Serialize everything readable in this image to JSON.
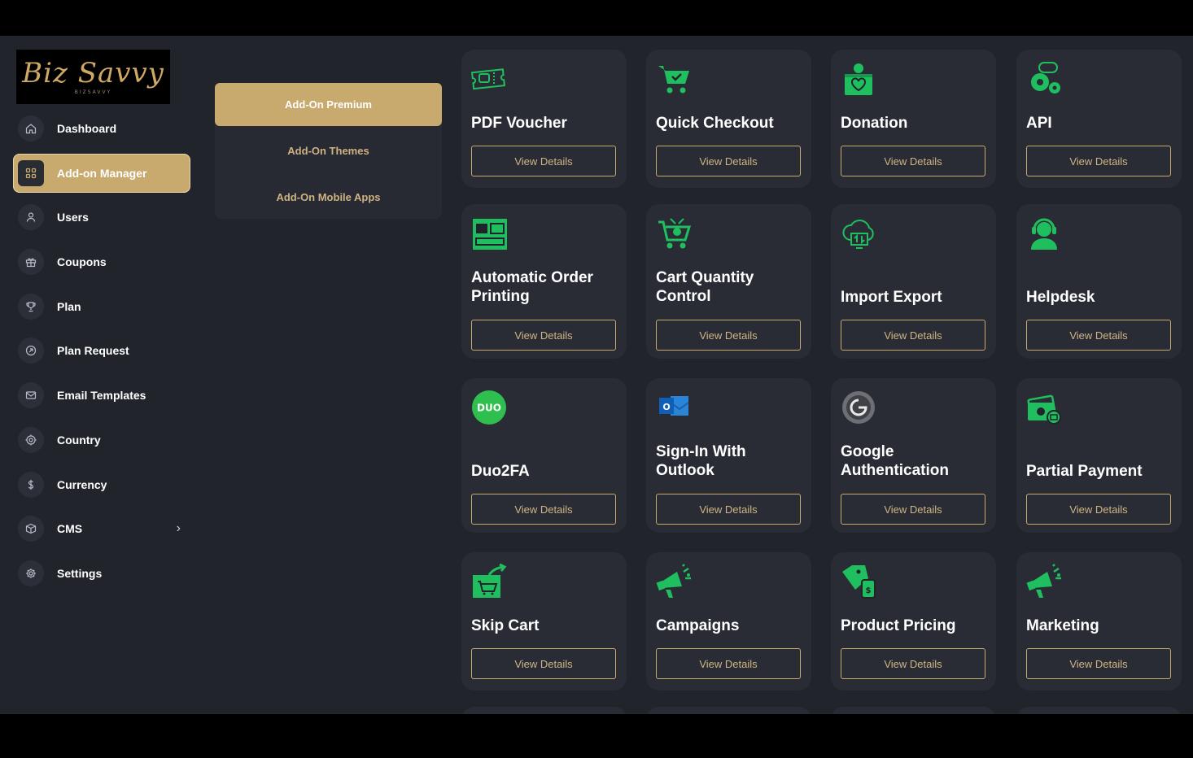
{
  "logo": {
    "script": "Biz Savvy",
    "sub": "BIZSAVVY"
  },
  "sidebar": {
    "items": [
      {
        "label": "Dashboard",
        "icon": "home-icon"
      },
      {
        "label": "Add-on Manager",
        "icon": "grid-icon"
      },
      {
        "label": "Users",
        "icon": "user-icon"
      },
      {
        "label": "Coupons",
        "icon": "gift-icon"
      },
      {
        "label": "Plan",
        "icon": "trophy-icon"
      },
      {
        "label": "Plan Request",
        "icon": "arrow-circle-icon"
      },
      {
        "label": "Email Templates",
        "icon": "mail-icon"
      },
      {
        "label": "Country",
        "icon": "target-icon"
      },
      {
        "label": "Currency",
        "icon": "dollar-icon"
      },
      {
        "label": "CMS",
        "icon": "box-icon"
      },
      {
        "label": "Settings",
        "icon": "gear-icon"
      }
    ],
    "active": "Add-on Manager"
  },
  "submenu": {
    "items": [
      "Add-On Premium",
      "Add-On Themes",
      "Add-On Mobile Apps"
    ],
    "active": "Add-On Premium"
  },
  "addons": {
    "button_label": "View Details",
    "items": [
      {
        "title": "PDF Voucher",
        "icon": "voucher-icon"
      },
      {
        "title": "Quick Checkout",
        "icon": "cart-check-icon"
      },
      {
        "title": "Donation",
        "icon": "donation-box-icon"
      },
      {
        "title": "API",
        "icon": "api-gears-icon"
      },
      {
        "title": "Automatic Order Printing",
        "icon": "printer-icon"
      },
      {
        "title": "Cart Quantity Control",
        "icon": "cart-quantity-icon"
      },
      {
        "title": "Import Export",
        "icon": "cloud-transfer-icon"
      },
      {
        "title": "Helpdesk",
        "icon": "headset-icon"
      },
      {
        "title": "Duo2FA",
        "icon": "duo-icon"
      },
      {
        "title": "Sign-In With Outlook",
        "icon": "outlook-icon"
      },
      {
        "title": "Google Authentication",
        "icon": "google-auth-icon"
      },
      {
        "title": "Partial Payment",
        "icon": "wallet-icon"
      },
      {
        "title": "Skip Cart",
        "icon": "skip-cart-icon"
      },
      {
        "title": "Campaigns",
        "icon": "megaphone-icon"
      },
      {
        "title": "Product Pricing",
        "icon": "price-tag-icon"
      },
      {
        "title": "Marketing",
        "icon": "megaphone-icon"
      }
    ]
  },
  "colors": {
    "accent": "#c8aa6e",
    "green": "#1fbf5f",
    "background": "#22242c",
    "card": "#2a2c35"
  }
}
